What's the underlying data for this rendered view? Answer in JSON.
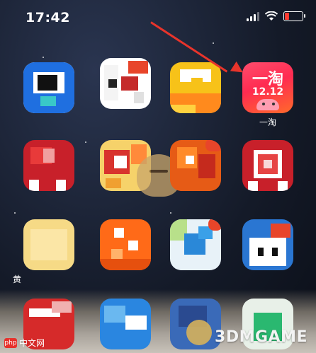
{
  "status_bar": {
    "time": "17:42"
  },
  "apps": [
    {
      "name": "app-blue-square",
      "label": ""
    },
    {
      "name": "app-red-white",
      "label": ""
    },
    {
      "name": "app-yellow-orange",
      "label": ""
    },
    {
      "name": "app-taobao",
      "label": "一淘",
      "icon_top": "一淘",
      "icon_date": "12.12"
    },
    {
      "name": "app-red-1",
      "label": ""
    },
    {
      "name": "app-red-yellow",
      "label": ""
    },
    {
      "name": "app-red-orange",
      "label": ""
    },
    {
      "name": "app-red-white-2",
      "label": ""
    },
    {
      "name": "app-yellow-cream",
      "label": "黄"
    },
    {
      "name": "app-orange-2",
      "label": ""
    },
    {
      "name": "app-green-blue",
      "label": ""
    },
    {
      "name": "app-blue-white",
      "label": ""
    }
  ],
  "watermarks": {
    "left_logo": "php",
    "left_text": "中文网",
    "right_text": "3DMGAME"
  },
  "colors": {
    "arrow": "#e8342b",
    "battery_low": "#ff3b30"
  }
}
